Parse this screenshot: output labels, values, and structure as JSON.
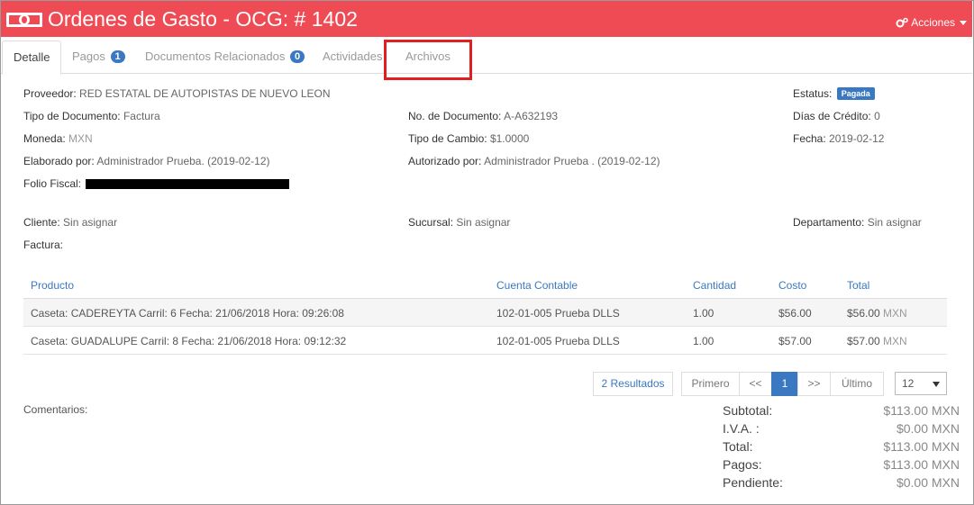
{
  "header": {
    "title": "Ordenes de Gasto - OCG: # 1402",
    "actions_label": "Acciones"
  },
  "tabs": [
    {
      "label": "Detalle",
      "badge": null,
      "active": true
    },
    {
      "label": "Pagos",
      "badge": "1"
    },
    {
      "label": "Documentos Relacionados",
      "badge": "0"
    },
    {
      "label": "Actividades",
      "badge": null
    },
    {
      "label": "Archivos",
      "badge": null
    }
  ],
  "details": {
    "proveedor": {
      "label": "Proveedor:",
      "value": "RED ESTATAL DE AUTOPISTAS DE NUEVO LEON"
    },
    "estatus": {
      "label": "Estatus:",
      "value": "Pagada"
    },
    "tipo_documento": {
      "label": "Tipo de Documento:",
      "value": "Factura"
    },
    "no_documento": {
      "label": "No. de Documento:",
      "value": "A-A632193"
    },
    "dias_credito": {
      "label": "Días de Crédito:",
      "value": "0"
    },
    "moneda": {
      "label": "Moneda:",
      "value": "MXN"
    },
    "tipo_cambio": {
      "label": "Tipo de Cambio:",
      "value": "$1.0000"
    },
    "fecha": {
      "label": "Fecha:",
      "value": "2019-02-12"
    },
    "elaborado": {
      "label": "Elaborado por:",
      "value": "Administrador Prueba. (2019-02-12)"
    },
    "autorizado": {
      "label": "Autorizado por:",
      "value": "Administrador Prueba . (2019-02-12)"
    },
    "folio": {
      "label": "Folio Fiscal:"
    },
    "cliente": {
      "label": "Cliente:",
      "value": "Sin asignar"
    },
    "sucursal": {
      "label": "Sucursal:",
      "value": "Sin asignar"
    },
    "departamento": {
      "label": "Departamento:",
      "value": "Sin asignar"
    },
    "factura": {
      "label": "Factura:"
    }
  },
  "table": {
    "headers": [
      "Producto",
      "Cuenta Contable",
      "Cantidad",
      "Costo",
      "Total"
    ],
    "rows": [
      {
        "producto": "Caseta: CADEREYTA Carril: 6 Fecha: 21/06/2018 Hora: 09:26:08",
        "cuenta": "102-01-005 Prueba DLLS",
        "cantidad": "1.00",
        "costo": "$56.00",
        "total": "$56.00",
        "currency": "MXN"
      },
      {
        "producto": "Caseta: GUADALUPE Carril: 8 Fecha: 21/06/2018 Hora: 09:12:32",
        "cuenta": "102-01-005 Prueba DLLS",
        "cantidad": "1.00",
        "costo": "$57.00",
        "total": "$57.00",
        "currency": "MXN"
      }
    ]
  },
  "pagination": {
    "results": "2 Resultados",
    "first": "Primero",
    "prev": "<<",
    "current": "1",
    "next": ">>",
    "last": "Último",
    "page_size": "12"
  },
  "comentarios_label": "Comentarios:",
  "totals": [
    {
      "label": "Subtotal:",
      "value": "$113.00 MXN"
    },
    {
      "label": "I.V.A. :",
      "value": "$0.00 MXN"
    },
    {
      "label": "Total:",
      "value": "$113.00 MXN"
    },
    {
      "label": "Pagos:",
      "value": "$113.00 MXN"
    },
    {
      "label": "Pendiente:",
      "value": "$0.00 MXN"
    }
  ],
  "colors": {
    "header_bg": "#ee4b55",
    "accent": "#3a79c1",
    "highlight": "#e02020"
  }
}
